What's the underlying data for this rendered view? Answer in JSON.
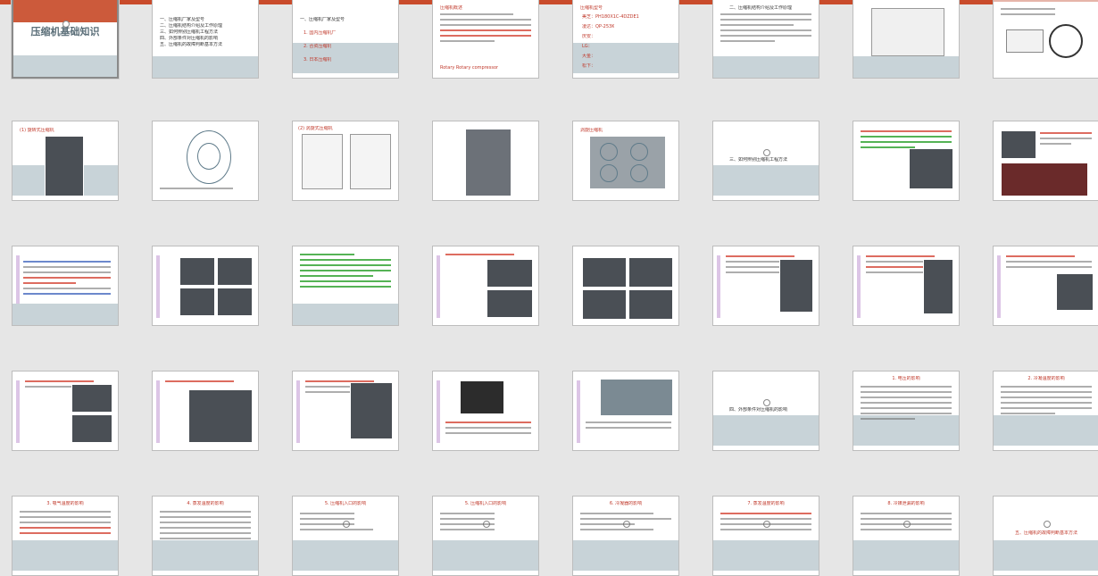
{
  "window": {
    "accent_color": "#c94b2b",
    "background": "#e6e6e6"
  },
  "cover": {
    "title": "压缩机基础知识"
  },
  "slides": [
    {
      "heading": "",
      "text": [
        "一、压缩机厂家及型号",
        "二、压缩机结构介绍及工作原理",
        "三、如何辨别压缩机工程方法",
        "四、外部条件对压缩机的影响",
        "五、压缩机的故障判断基本方法"
      ]
    },
    {
      "heading": "一、压缩机厂家及型号",
      "text": [
        "1. 国内压缩机厂",
        "2. 合资压缩机",
        "3. 日本压缩机"
      ]
    },
    {
      "heading": "压缩机概述",
      "text": [
        "Rotary  Rotary  compressor"
      ]
    },
    {
      "heading": "压缩机型号",
      "text": [
        "美芝：PH180X1C-4DZDE1",
        "凌达：QP-253K",
        "庆安：",
        "LG：",
        "大金：",
        "松下："
      ]
    },
    {
      "heading": "二、压缩机结构介绍及工作原理",
      "text": []
    },
    {
      "heading": "",
      "text": []
    },
    {
      "heading": "",
      "text": []
    },
    {
      "heading": "(1) 旋转式压缩机",
      "text": []
    },
    {
      "heading": "",
      "text": []
    },
    {
      "heading": "(2) 涡旋式压缩机",
      "text": []
    },
    {
      "heading": "",
      "text": []
    },
    {
      "heading": "涡旋压缩机",
      "text": []
    },
    {
      "heading": "三、如何辨别压缩机工程方法",
      "text": []
    },
    {
      "heading": "",
      "text": []
    },
    {
      "heading": "",
      "text": []
    },
    {
      "heading": "",
      "text": []
    },
    {
      "heading": "",
      "text": []
    },
    {
      "heading": "",
      "text": []
    },
    {
      "heading": "",
      "text": []
    },
    {
      "heading": "",
      "text": []
    },
    {
      "heading": "",
      "text": []
    },
    {
      "heading": "",
      "text": []
    },
    {
      "heading": "",
      "text": []
    },
    {
      "heading": "",
      "text": []
    },
    {
      "heading": "",
      "text": []
    },
    {
      "heading": "",
      "text": []
    },
    {
      "heading": "",
      "text": []
    },
    {
      "heading": "",
      "text": []
    },
    {
      "heading": "",
      "text": []
    },
    {
      "heading": "四、外部条件对压缩机的影响",
      "text": []
    },
    {
      "heading": "1. 电压的影响",
      "text": []
    },
    {
      "heading": "2. 冷凝温度的影响",
      "text": []
    },
    {
      "heading": "3. 吸气温度的影响",
      "text": []
    },
    {
      "heading": "4. 蒸发温度的影响",
      "text": []
    },
    {
      "heading": "5. 压缩机入口的影响",
      "text": []
    },
    {
      "heading": "5. 压缩机入口的影响",
      "text": []
    },
    {
      "heading": "6. 冷凝器的影响",
      "text": []
    },
    {
      "heading": "7. 蒸发温度的影响",
      "text": []
    },
    {
      "heading": "8. 冷媒泄漏的影响",
      "text": []
    },
    {
      "heading": "五、压缩机的故障判断基本方法",
      "text": []
    }
  ]
}
